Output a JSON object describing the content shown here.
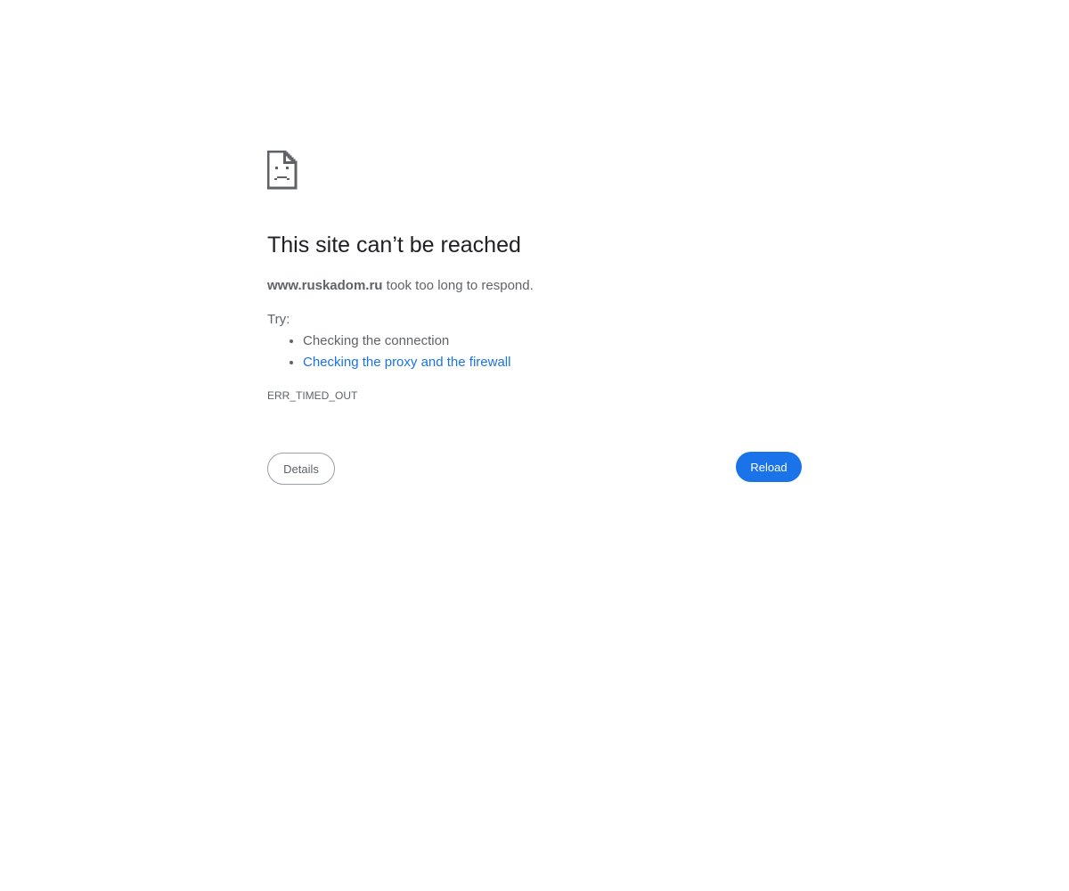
{
  "error_page": {
    "icon": "sad-document-icon",
    "title": "This site can’t be reached",
    "host": "www.ruskadom.ru",
    "summary_suffix": " took too long to respond.",
    "try_label": "Try:",
    "suggestions": [
      {
        "label": "Checking the connection",
        "is_link": false
      },
      {
        "label": "Checking the proxy and the firewall",
        "is_link": true
      }
    ],
    "error_code": "ERR_TIMED_OUT"
  },
  "buttons": {
    "details_label": "Details",
    "reload_label": "Reload"
  },
  "colors": {
    "link": "#1a73e8",
    "primary_button": "#1a73e8",
    "heading": "#202124",
    "body_text": "#5f6368"
  }
}
